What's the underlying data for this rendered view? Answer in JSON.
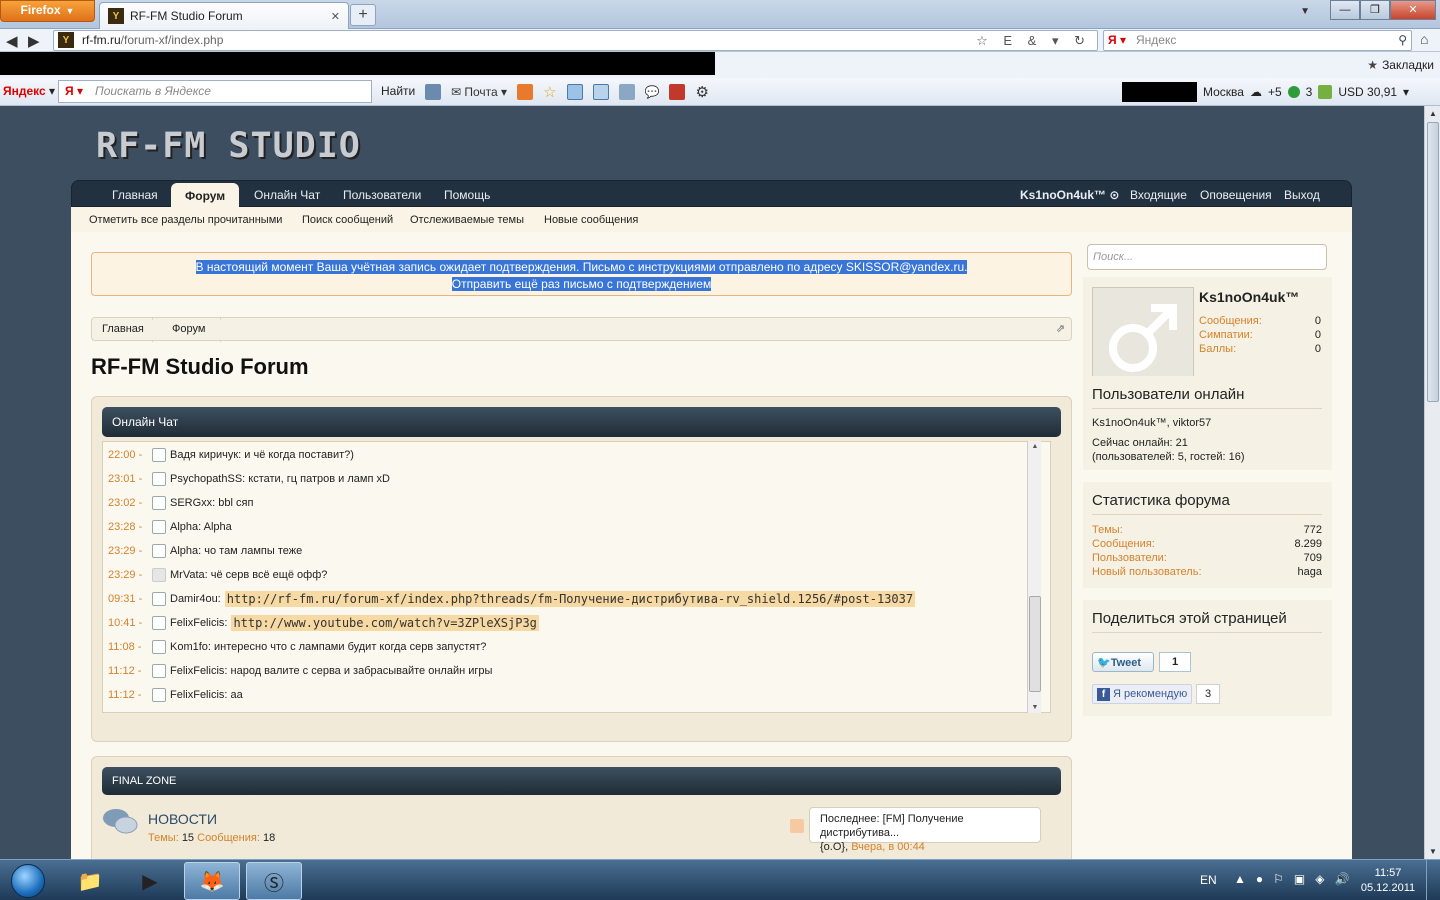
{
  "browser": {
    "menu_button": "Firefox",
    "tab_title": "RF-FM Studio Forum",
    "url_domain": "rf-fm.ru",
    "url_path": "/forum-xf/index.php",
    "search_placeholder": "Яндекс",
    "bookmarks_label": "Закладки"
  },
  "yandex_bar": {
    "menu": "Яндекс",
    "search_placeholder": "Поискать в Яндексе",
    "find_button": "Найти",
    "mail": "Почта",
    "city": "Москва",
    "temp": "+5",
    "count": "3",
    "currency": "USD 30,91"
  },
  "site": {
    "logo": "RF-FM STUDIO",
    "nav": [
      "Главная",
      "Форум",
      "Онлайн Чат",
      "Пользователи",
      "Помощь"
    ],
    "user_menu": [
      "Ks1noOn4uk™",
      "Входящие",
      "Оповещения",
      "Выход"
    ],
    "subnav": [
      "Отметить все разделы прочитанными",
      "Поиск сообщений",
      "Отслеживаемые темы",
      "Новые сообщения"
    ],
    "notice_line1": "В настоящий момент Ваша учётная запись ожидает подтверждения. Письмо с инструкциями отправлено по адресу SKISSOR@yandex.ru.",
    "notice_line2": "Отправить ещё раз письмо с подтверждением",
    "breadcrumb": [
      "Главная",
      "Форум"
    ],
    "page_title": "RF-FM Studio Forum"
  },
  "chat": {
    "title": "Онлайн Чат",
    "messages": [
      {
        "time": "22:00 -",
        "text": "Вадя киричук: и чё когда поставит?)",
        "link": ""
      },
      {
        "time": "23:01 -",
        "text": "PsychopathSS: кстати, гц патров и ламп xD",
        "link": ""
      },
      {
        "time": "23:02 -",
        "text": "SERGxx: bbl сяп",
        "link": ""
      },
      {
        "time": "23:28 -",
        "text": "Alpha: Alpha",
        "link": ""
      },
      {
        "time": "23:29 -",
        "text": "Alpha: чо там лампы теже",
        "link": ""
      },
      {
        "time": "23:29 -",
        "text": "MrVata: чё серв всё ещё офф?",
        "link": ""
      },
      {
        "time": "09:31 -",
        "text": "Damir4ou:",
        "link": "http://rf-fm.ru/forum-xf/index.php?threads/fm-Получение-дистрибутива-rv_shield.1256/#post-13037"
      },
      {
        "time": "10:41 -",
        "text": "FelixFelicis:",
        "link": "http://www.youtube.com/watch?v=3ZPleXSjP3g"
      },
      {
        "time": "11:08 -",
        "text": "Kom1fo: интересно что с лампами будит когда серв запустят?",
        "link": ""
      },
      {
        "time": "11:12 -",
        "text": "FelixFelicis: народ валите с серва и забрасывайте онлайн игры",
        "link": ""
      },
      {
        "time": "11:12 -",
        "text": "FelixFelicis: аа",
        "link": ""
      }
    ]
  },
  "zone": {
    "title": "FINAL ZONE",
    "forum_name": "НОВОСТИ",
    "threads_label": "Темы:",
    "threads": "15",
    "posts_label": "Сообщения:",
    "posts": "18",
    "last_label": "Последнее:",
    "last_title": "[FM] Получение дистрибутива...",
    "last_user": "{o.O},",
    "last_date": "Вчера, в 00:44"
  },
  "sidebar": {
    "search_placeholder": "Поиск...",
    "profile": {
      "name": "Ks1noOn4uk™",
      "rows": [
        {
          "k": "Сообщения:",
          "v": "0"
        },
        {
          "k": "Симпатии:",
          "v": "0"
        },
        {
          "k": "Баллы:",
          "v": "0"
        }
      ]
    },
    "online": {
      "title": "Пользователи онлайн",
      "users": "Ks1noOn4uk™, viktor57",
      "now": "Сейчас онлайн: 21",
      "detail": "(пользователей: 5, гостей: 16)"
    },
    "stats": {
      "title": "Статистика форума",
      "rows": [
        {
          "k": "Темы:",
          "v": "772"
        },
        {
          "k": "Сообщения:",
          "v": "8.299"
        },
        {
          "k": "Пользователи:",
          "v": "709"
        },
        {
          "k": "Новый пользователь:",
          "v": "haga"
        }
      ]
    },
    "share": {
      "title": "Поделиться этой страницей",
      "tweet": "Tweet",
      "tweet_count": "1",
      "fb": "Я рекомендую",
      "fb_count": "3"
    }
  },
  "taskbar": {
    "lang": "EN",
    "time": "11:57",
    "date": "05.12.2011"
  }
}
